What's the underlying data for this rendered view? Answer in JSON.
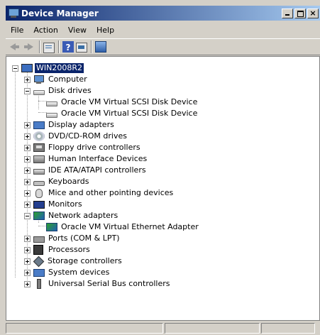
{
  "window": {
    "title": "Device Manager"
  },
  "menu": [
    "File",
    "Action",
    "View",
    "Help"
  ],
  "tree": {
    "root": "WIN2008R2",
    "categories": [
      {
        "label": "Computer",
        "expanded": false
      },
      {
        "label": "Disk drives",
        "expanded": true,
        "children": [
          "Oracle VM Virtual SCSI Disk Device",
          "Oracle VM Virtual SCSI Disk Device"
        ]
      },
      {
        "label": "Display adapters",
        "expanded": false
      },
      {
        "label": "DVD/CD-ROM drives",
        "expanded": false
      },
      {
        "label": "Floppy drive controllers",
        "expanded": false
      },
      {
        "label": "Human Interface Devices",
        "expanded": false
      },
      {
        "label": "IDE ATA/ATAPI controllers",
        "expanded": false
      },
      {
        "label": "Keyboards",
        "expanded": false
      },
      {
        "label": "Mice and other pointing devices",
        "expanded": false
      },
      {
        "label": "Monitors",
        "expanded": false
      },
      {
        "label": "Network adapters",
        "expanded": true,
        "children": [
          "Oracle VM Virtual Ethernet Adapter"
        ]
      },
      {
        "label": "Ports (COM & LPT)",
        "expanded": false
      },
      {
        "label": "Processors",
        "expanded": false
      },
      {
        "label": "Storage controllers",
        "expanded": false
      },
      {
        "label": "System devices",
        "expanded": false
      },
      {
        "label": "Universal Serial Bus controllers",
        "expanded": false
      }
    ]
  },
  "statusbar": {
    "panes": [
      "",
      "",
      "",
      ""
    ]
  },
  "colors": {
    "titlebar_start": "#0a246a",
    "titlebar_end": "#a6caf0",
    "selection": "#0a246a",
    "chrome": "#d4d0c8"
  }
}
